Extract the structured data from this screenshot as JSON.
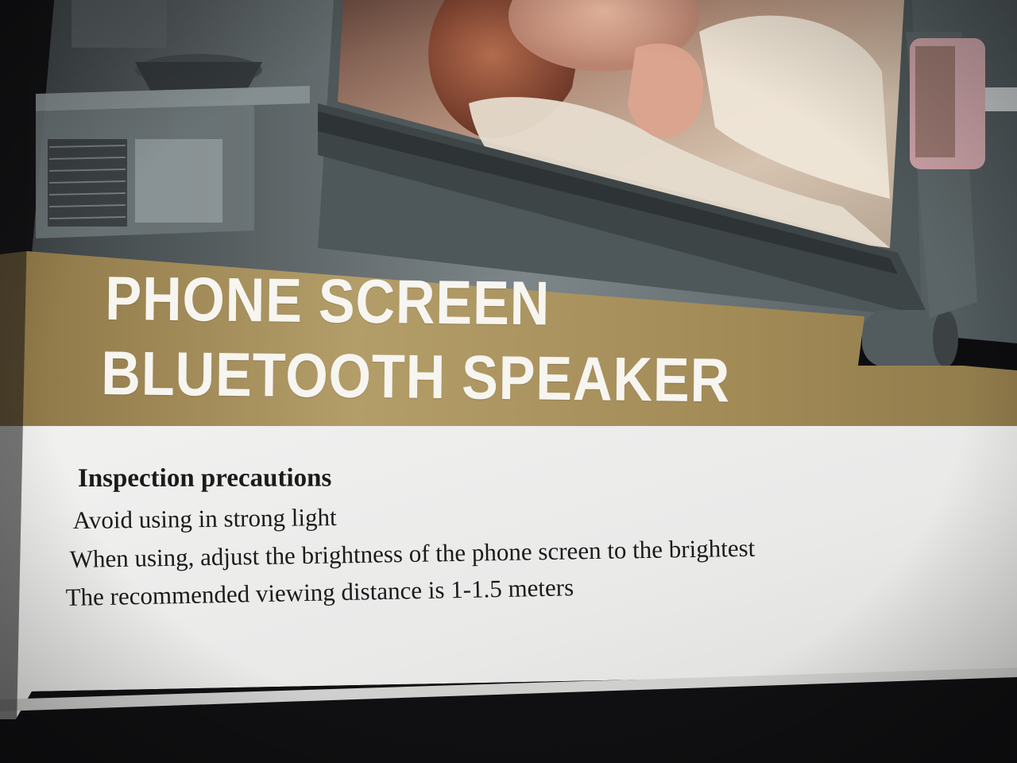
{
  "product_title": {
    "line1": "PHONE SCREEN",
    "line2": "BLUETOOTH SPEAKER"
  },
  "precautions": {
    "heading": "Inspection precautions",
    "items": [
      "Avoid using in strong light",
      "When using, adjust the brightness of the phone screen to the brightest",
      "The recommended viewing distance is 1-1.5 meters"
    ]
  },
  "colors": {
    "banner_gold": "#a8925d",
    "title_text": "#f7f5f0",
    "panel_white": "#ecebea",
    "body_text": "#1b1b1b",
    "device_grey": "#5a6467"
  }
}
